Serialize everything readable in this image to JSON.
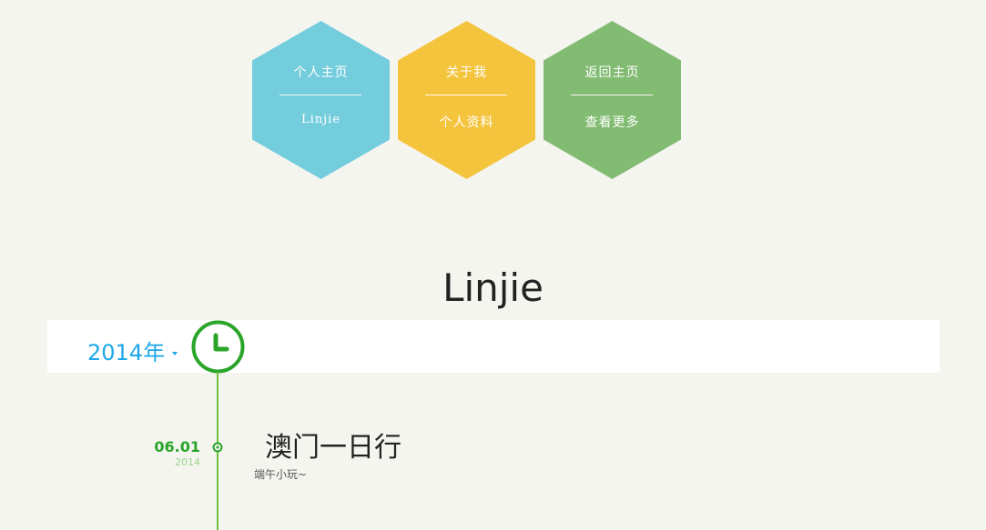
{
  "nav_hexes": [
    {
      "line1": "个人主页",
      "line2": "Linjie",
      "color": "#74cddc"
    },
    {
      "line1": "关于我",
      "line2": "个人资料",
      "color": "#f4c43d"
    },
    {
      "line1": "返回主页",
      "line2": "查看更多",
      "color": "#82bb72"
    }
  ],
  "site_title": "Linjie",
  "timeline": {
    "year_label": "2014年",
    "accent_color": "#2aa52a",
    "year_color": "#1ea8e8",
    "events": [
      {
        "date": "06.01",
        "year": "2014",
        "title": "澳门一日行",
        "desc": "端午小玩~"
      }
    ]
  }
}
